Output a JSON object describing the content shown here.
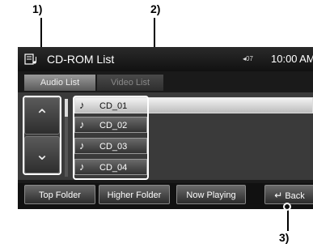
{
  "callouts": [
    "1)",
    "2)",
    "3)"
  ],
  "header": {
    "icon": "document-music-icon",
    "title": "CD-ROM List",
    "volume": "◂07",
    "clock": "10:00 AM"
  },
  "tabs": [
    {
      "label": "Audio List",
      "active": true
    },
    {
      "label": "Video List",
      "active": false
    }
  ],
  "scroll": {
    "up_icon": "⌃",
    "down_icon": "⌄"
  },
  "tracks": [
    {
      "icon": "♪",
      "label": "CD_01",
      "selected": true
    },
    {
      "icon": "♪",
      "label": "CD_02",
      "selected": false
    },
    {
      "icon": "♪",
      "label": "CD_03",
      "selected": false
    },
    {
      "icon": "♪",
      "label": "CD_04",
      "selected": false
    }
  ],
  "buttons": {
    "top_folder": "Top Folder",
    "higher_folder": "Higher Folder",
    "now_playing": "Now Playing",
    "back": "Back",
    "back_icon": "↵"
  },
  "colors": {
    "screen_bg": "#1a1a1a",
    "callout_frame": "#ffffff"
  }
}
